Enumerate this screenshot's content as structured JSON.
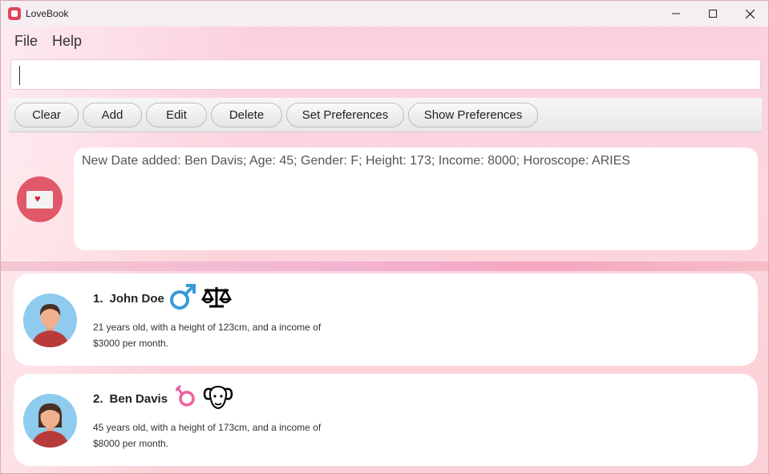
{
  "window": {
    "title": "LoveBook"
  },
  "menu": {
    "file": "File",
    "help": "Help"
  },
  "command": {
    "value": ""
  },
  "toolbar": {
    "clear": "Clear",
    "add": "Add",
    "edit": "Edit",
    "delete": "Delete",
    "set_preferences": "Set Preferences",
    "show_preferences": "Show Preferences"
  },
  "result": {
    "message": "New Date added: Ben Davis; Age: 45; Gender: F; Height: 173; Income: 8000; Horoscope: ARIES"
  },
  "dates": [
    {
      "index": "1.",
      "name": "John Doe",
      "gender_icon": "male-symbol",
      "zodiac_icon": "libra-symbol",
      "line1": "21 years old, with a height of 123cm, and a income of",
      "line2": "$3000 per month."
    },
    {
      "index": "2.",
      "name": "Ben Davis",
      "gender_icon": "female-symbol",
      "zodiac_icon": "aries-symbol",
      "line1": "45 years old, with a height of 173cm, and a income of",
      "line2": "$8000 per month."
    }
  ],
  "colors": {
    "male": "#3a9ad9",
    "female": "#ef5fa0",
    "accent": "#e15868",
    "avatar_bg": "#8ecbef"
  }
}
